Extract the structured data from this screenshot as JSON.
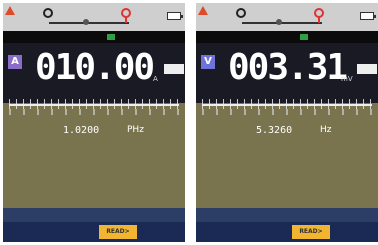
{
  "left": {
    "alert_text": "",
    "status": [
      "",
      "",
      ""
    ],
    "mode_letter": "A",
    "reading": "010.00",
    "unit": "A",
    "hold_label": "",
    "secondary": {
      "label": "",
      "value": "1.0200",
      "unit": "PHz"
    },
    "message": "",
    "softkeys": [
      "",
      "",
      "READ>",
      ""
    ]
  },
  "right": {
    "alert_text": "",
    "status": [
      "",
      "",
      ""
    ],
    "mode_letter": "V",
    "reading": "003.31",
    "unit": "mV",
    "hold_label": "",
    "secondary": {
      "label": "",
      "value": "5.3260",
      "unit": "Hz"
    },
    "message": "",
    "softkeys": [
      "",
      "",
      "READ>",
      ""
    ]
  },
  "icons": [
    "warning-icon",
    "probe-icon",
    "battery-icon",
    "hold-icon"
  ],
  "colors": {
    "mode_current": "#8a6cc9",
    "mode_voltage": "#6f72d8",
    "read_key": "#f2b531",
    "softkey_bar": "#1b2a55",
    "warning": "#e04a2a"
  }
}
